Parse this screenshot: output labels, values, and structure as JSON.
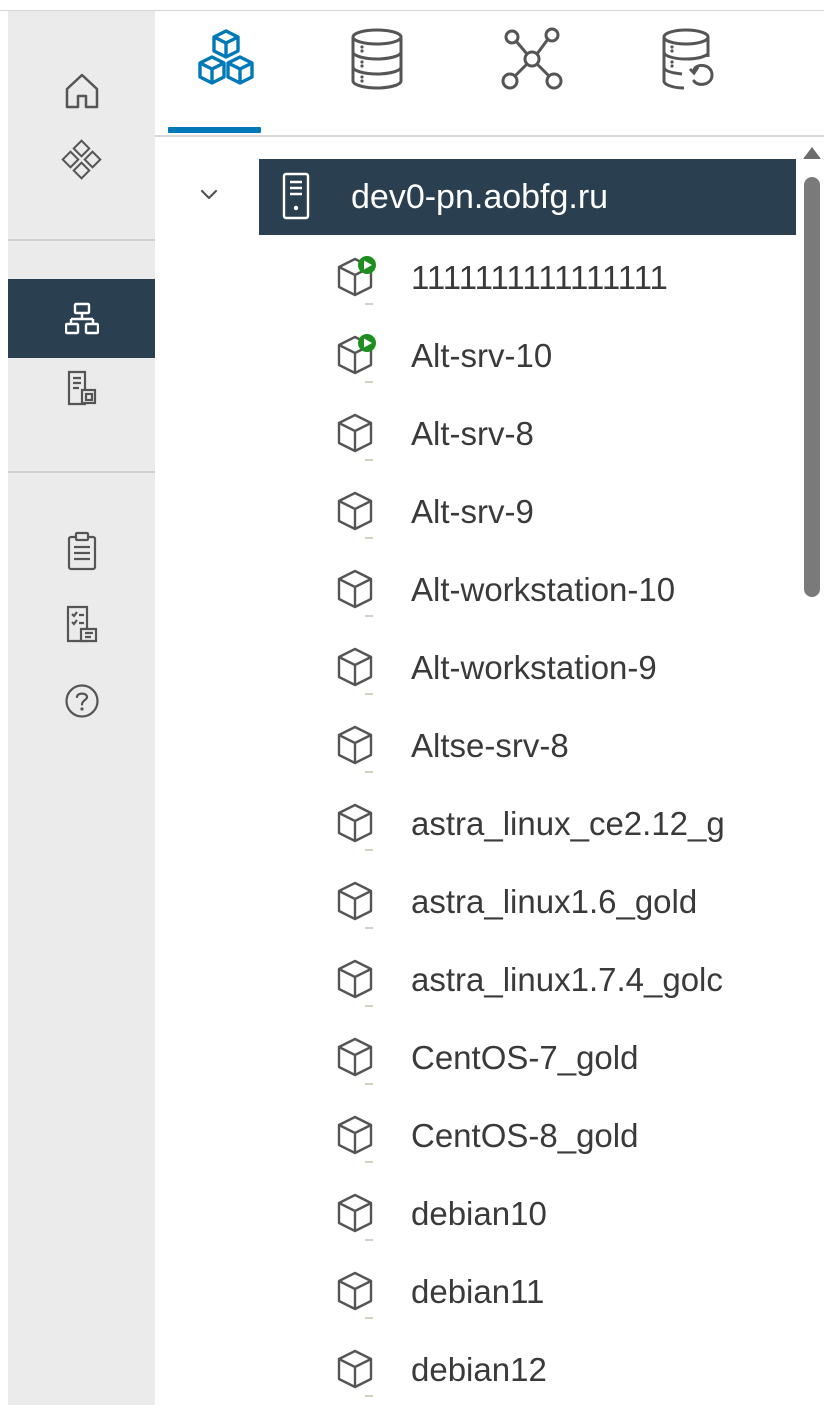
{
  "rail": {
    "items": [
      {
        "icon": "home-icon"
      },
      {
        "icon": "shortcuts-icon"
      },
      {
        "icon": "inventory-tree-icon",
        "active": true
      },
      {
        "icon": "content-libraries-icon"
      },
      {
        "icon": "tasks-icon"
      },
      {
        "icon": "policies-icon"
      },
      {
        "icon": "help-icon"
      }
    ]
  },
  "tabs": [
    {
      "icon": "hosts-clusters-icon",
      "active": true
    },
    {
      "icon": "storage-icon"
    },
    {
      "icon": "networking-icon"
    },
    {
      "icon": "backup-storage-icon"
    }
  ],
  "tree": {
    "host": {
      "label": "dev0-pn.aobfg.ru",
      "expanded": true
    },
    "vms": [
      {
        "label": "1111111111111111",
        "running": true
      },
      {
        "label": "Alt-srv-10",
        "running": true
      },
      {
        "label": "Alt-srv-8",
        "running": false
      },
      {
        "label": "Alt-srv-9",
        "running": false
      },
      {
        "label": "Alt-workstation-10",
        "running": false
      },
      {
        "label": "Alt-workstation-9",
        "running": false
      },
      {
        "label": "Altse-srv-8",
        "running": false
      },
      {
        "label": "astra_linux_ce2.12_g",
        "running": false
      },
      {
        "label": "astra_linux1.6_gold",
        "running": false
      },
      {
        "label": "astra_linux1.7.4_golc",
        "running": false
      },
      {
        "label": "CentOS-7_gold",
        "running": false
      },
      {
        "label": "CentOS-8_gold",
        "running": false
      },
      {
        "label": "debian10",
        "running": false
      },
      {
        "label": "debian11",
        "running": false
      },
      {
        "label": "debian12",
        "running": false
      }
    ]
  },
  "colors": {
    "rail_bg": "#ebebeb",
    "selected_bg": "#2a3f4f",
    "accent": "#0079b8",
    "running_green": "#1e8f1e"
  }
}
